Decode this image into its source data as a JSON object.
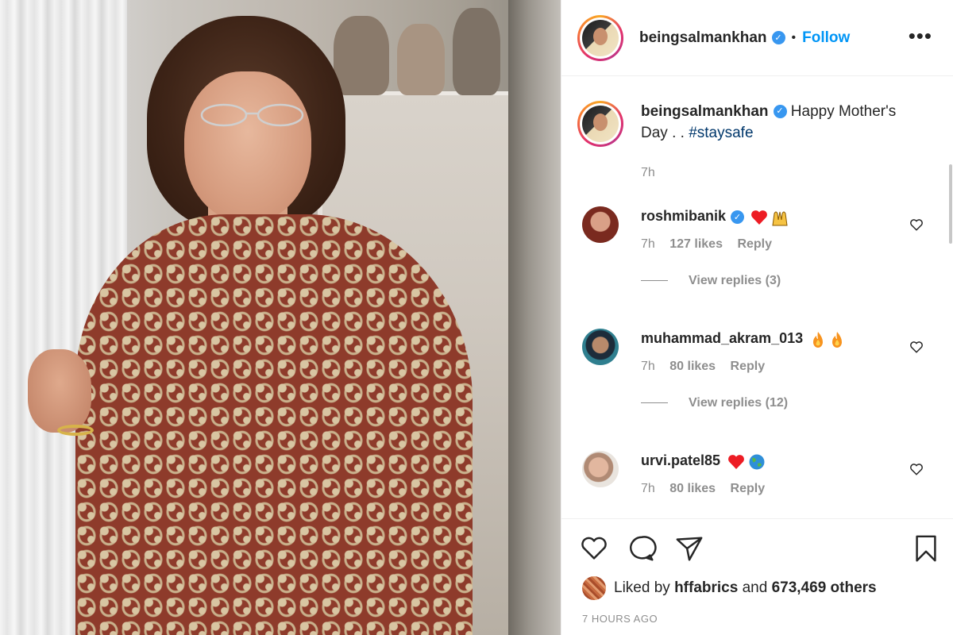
{
  "post": {
    "username": "beingsalmankhan",
    "follow_label": "Follow",
    "separator": "•",
    "more_label": "•••"
  },
  "caption": {
    "username": "beingsalmankhan",
    "text": "Happy Mother's Day . . ",
    "hashtag": "#staysafe",
    "time": "7h"
  },
  "comments": [
    {
      "username": "roshmibanik",
      "emojis": [
        "heart",
        "raised-hands"
      ],
      "time": "7h",
      "likes": "127 likes",
      "reply": "Reply",
      "view_replies": "View replies (3)"
    },
    {
      "username": "muhammad_akram_013",
      "emojis": [
        "fire",
        "fire"
      ],
      "time": "7h",
      "likes": "80 likes",
      "reply": "Reply",
      "view_replies": "View replies (12)"
    },
    {
      "username": "urvi.patel85",
      "emojis": [
        "heart",
        "globe"
      ],
      "time": "7h",
      "likes": "80 likes",
      "reply": "Reply"
    }
  ],
  "likes": {
    "prefix": "Liked by ",
    "liker": "hffabrics",
    "middle": " and ",
    "count": "673,469 others"
  },
  "timestamp": "7 HOURS AGO",
  "colors": {
    "link_blue": "#0095f6",
    "hashtag_blue": "#00376b",
    "muted_gray": "#8e8e8e",
    "text": "#262626",
    "heart_red": "#ed1c24"
  }
}
